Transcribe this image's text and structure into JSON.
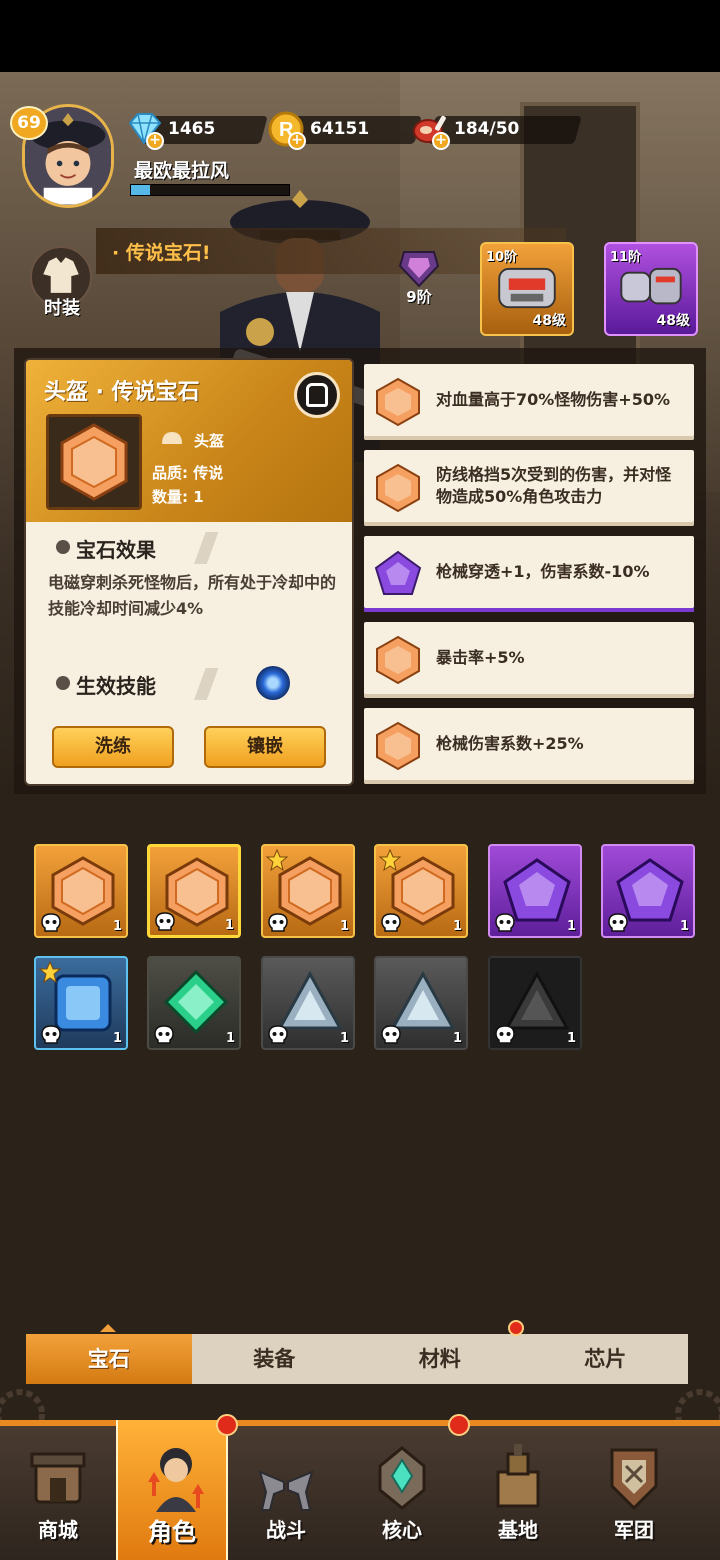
{
  "player": {
    "level": "69",
    "name": "最欧最拉风",
    "exp_progress": 0.12
  },
  "resources": [
    {
      "id": "diamond",
      "icon": "diamond-icon",
      "value": "1465"
    },
    {
      "id": "gold",
      "icon": "gold-coin-icon",
      "value": "64151"
    },
    {
      "id": "stamina",
      "icon": "meat-icon",
      "value": "184/50"
    }
  ],
  "banner": {
    "text": "· 传说宝石!"
  },
  "side": {
    "costume_label": "时装"
  },
  "equip": {
    "tier9_label": "9阶",
    "slot1_tier": "10阶",
    "slot1_level": "48级",
    "slot2_tier": "11阶",
    "slot2_level": "48级"
  },
  "card": {
    "title": "头盔 · 传说宝石",
    "slot": "头盔",
    "quality": "品质: 传说",
    "count": "数量: 1",
    "effect_title": "宝石效果",
    "effect_text": "电磁穿刺杀死怪物后，所有处于冷却中的技能冷却时间减少4%",
    "skill_title": "生效技能",
    "refine_label": "洗练",
    "inlay_label": "镶嵌"
  },
  "effects": [
    {
      "text": "对血量高于70%怪物伤害+50%",
      "gem": "orange"
    },
    {
      "text": "防线格挡5次受到的伤害，并对怪物造成50%角色攻击力",
      "gem": "orange"
    },
    {
      "text": "枪械穿透+1，伤害系数-10%",
      "gem": "purple"
    },
    {
      "text": "暴击率+5%",
      "gem": "orange"
    },
    {
      "text": "枪械伤害系数+25%",
      "gem": "orange"
    }
  ],
  "inventory": [
    {
      "rarity": "orange",
      "count": "1",
      "star": false
    },
    {
      "rarity": "orange-sel",
      "count": "1",
      "star": false
    },
    {
      "rarity": "orange",
      "count": "1",
      "star": true
    },
    {
      "rarity": "orange",
      "count": "1",
      "star": true
    },
    {
      "rarity": "purple",
      "count": "1",
      "star": false
    },
    {
      "rarity": "purple",
      "count": "1",
      "star": false
    },
    {
      "rarity": "blue",
      "count": "1",
      "star": true
    },
    {
      "rarity": "green",
      "count": "1",
      "star": false
    },
    {
      "rarity": "gray",
      "count": "1",
      "star": false
    },
    {
      "rarity": "gray",
      "count": "1",
      "star": false
    },
    {
      "rarity": "black",
      "count": "1",
      "star": false
    }
  ],
  "tabs": [
    "宝石",
    "装备",
    "材料",
    "芯片"
  ],
  "nav": [
    {
      "label": "商城",
      "icon": "shop-icon"
    },
    {
      "label": "角色",
      "icon": "character-icon"
    },
    {
      "label": "战斗",
      "icon": "battle-icon"
    },
    {
      "label": "核心",
      "icon": "core-icon"
    },
    {
      "label": "基地",
      "icon": "base-icon"
    },
    {
      "label": "军团",
      "icon": "legion-icon"
    }
  ],
  "colors": {
    "accent": "#f0a820",
    "legendary": "#e07a2c",
    "epic": "#8a3ad0",
    "panel": "#f7efe0"
  }
}
